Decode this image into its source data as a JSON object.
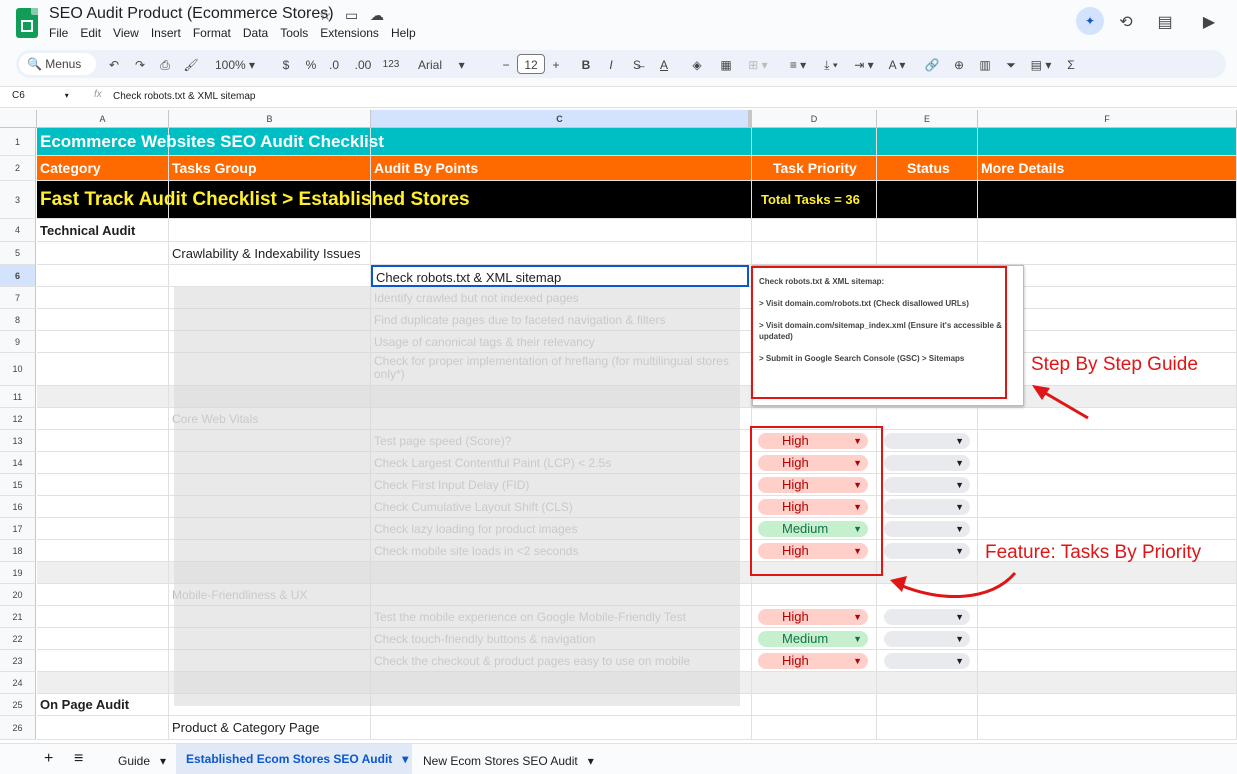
{
  "doc": {
    "title": "SEO Audit Product (Ecommerce Stores)",
    "menu": [
      "File",
      "Edit",
      "View",
      "Insert",
      "Format",
      "Data",
      "Tools",
      "Extensions",
      "Help"
    ]
  },
  "toolbar": {
    "menus_label": "Menus",
    "zoom": "100%",
    "currency": "$",
    "percent": "%",
    "dec_dec": ".0",
    "dec_inc": ".00",
    "format_num": "123",
    "font": "Arial",
    "font_size": "12",
    "minus": "−",
    "plus": "+",
    "bold": "B",
    "italic": "I",
    "strike": "S̶",
    "color_a": "A"
  },
  "formula": {
    "cell_ref": "C6",
    "fx": "fx",
    "content": "Check robots.txt & XML sitemap"
  },
  "columns": [
    "A",
    "B",
    "C",
    "D",
    "E",
    "F"
  ],
  "rows": [
    "1",
    "2",
    "3",
    "4",
    "5",
    "6",
    "7",
    "8",
    "9",
    "10",
    "11",
    "12",
    "13",
    "14",
    "15",
    "16",
    "17",
    "18",
    "19",
    "20",
    "21",
    "22",
    "23",
    "24",
    "25",
    "26"
  ],
  "sheet": {
    "r1": "Ecommerce Websites SEO Audit Checklist",
    "r2": {
      "a": "Category",
      "b": "Tasks Group",
      "c": "Audit By Points",
      "d": "Task Priority",
      "e": "Status",
      "f": "More Details"
    },
    "r3": {
      "a": "Fast Track Audit Checklist > Established Stores",
      "d": "Total Tasks = 36"
    },
    "r4": "Technical Audit",
    "r5": "Crawlability & Indexability Issues",
    "r6": "Check robots.txt & XML sitemap",
    "r7": "Identify crawled but not indexed pages",
    "r8": "Find duplicate pages due to faceted navigation & filters",
    "r9": "Usage of canonical tags & their relevancy",
    "r10": "Check for proper implementation of hreflang (for multilingual stores only*)",
    "r12": "Core Web Vitals",
    "r13": "Test page speed (Score)?",
    "r14": "Check Largest Contentful Paint (LCP) < 2.5s",
    "r15": "Check First Input Delay (FID)",
    "r16": "Check Cumulative Layout Shift (CLS)",
    "r17": "Check lazy loading for product images",
    "r18": "Check mobile site loads in <2 seconds",
    "r20": "Mobile-Friendliness & UX",
    "r21": "Test the mobile experience on Google Mobile-Friendly Test",
    "r22": "Check touch-friendly buttons & navigation",
    "r23": "Check the checkout & product pages easy to use on mobile",
    "r25": "On Page Audit",
    "r26": "Product & Category Page"
  },
  "priorities": {
    "r13": "High",
    "r14": "High",
    "r15": "High",
    "r16": "High",
    "r17": "Medium",
    "r18": "High",
    "r21": "High",
    "r22": "Medium",
    "r23": "High"
  },
  "note": {
    "l1": "Check robots.txt & XML sitemap:",
    "l2": "> Visit domain.com/robots.txt (Check disallowed URLs)",
    "l3": "> Visit domain.com/sitemap_index.xml (Ensure it's accessible & updated)",
    "l4": "> Submit in Google Search Console (GSC) > Sitemaps"
  },
  "callouts": {
    "guide": "Step By Step Guide",
    "priority": "Feature: Tasks By Priority"
  },
  "tabs": {
    "add": "+",
    "all": "≡",
    "guide": "Guide",
    "active": "Established Ecom Stores SEO Audit",
    "new": "New Ecom Stores SEO Audit"
  },
  "colors": {
    "teal": "#00bfc4",
    "orange": "#ff6a00",
    "high": "#ffcfc9",
    "medium": "#c6efce",
    "callout": "#e01515"
  }
}
